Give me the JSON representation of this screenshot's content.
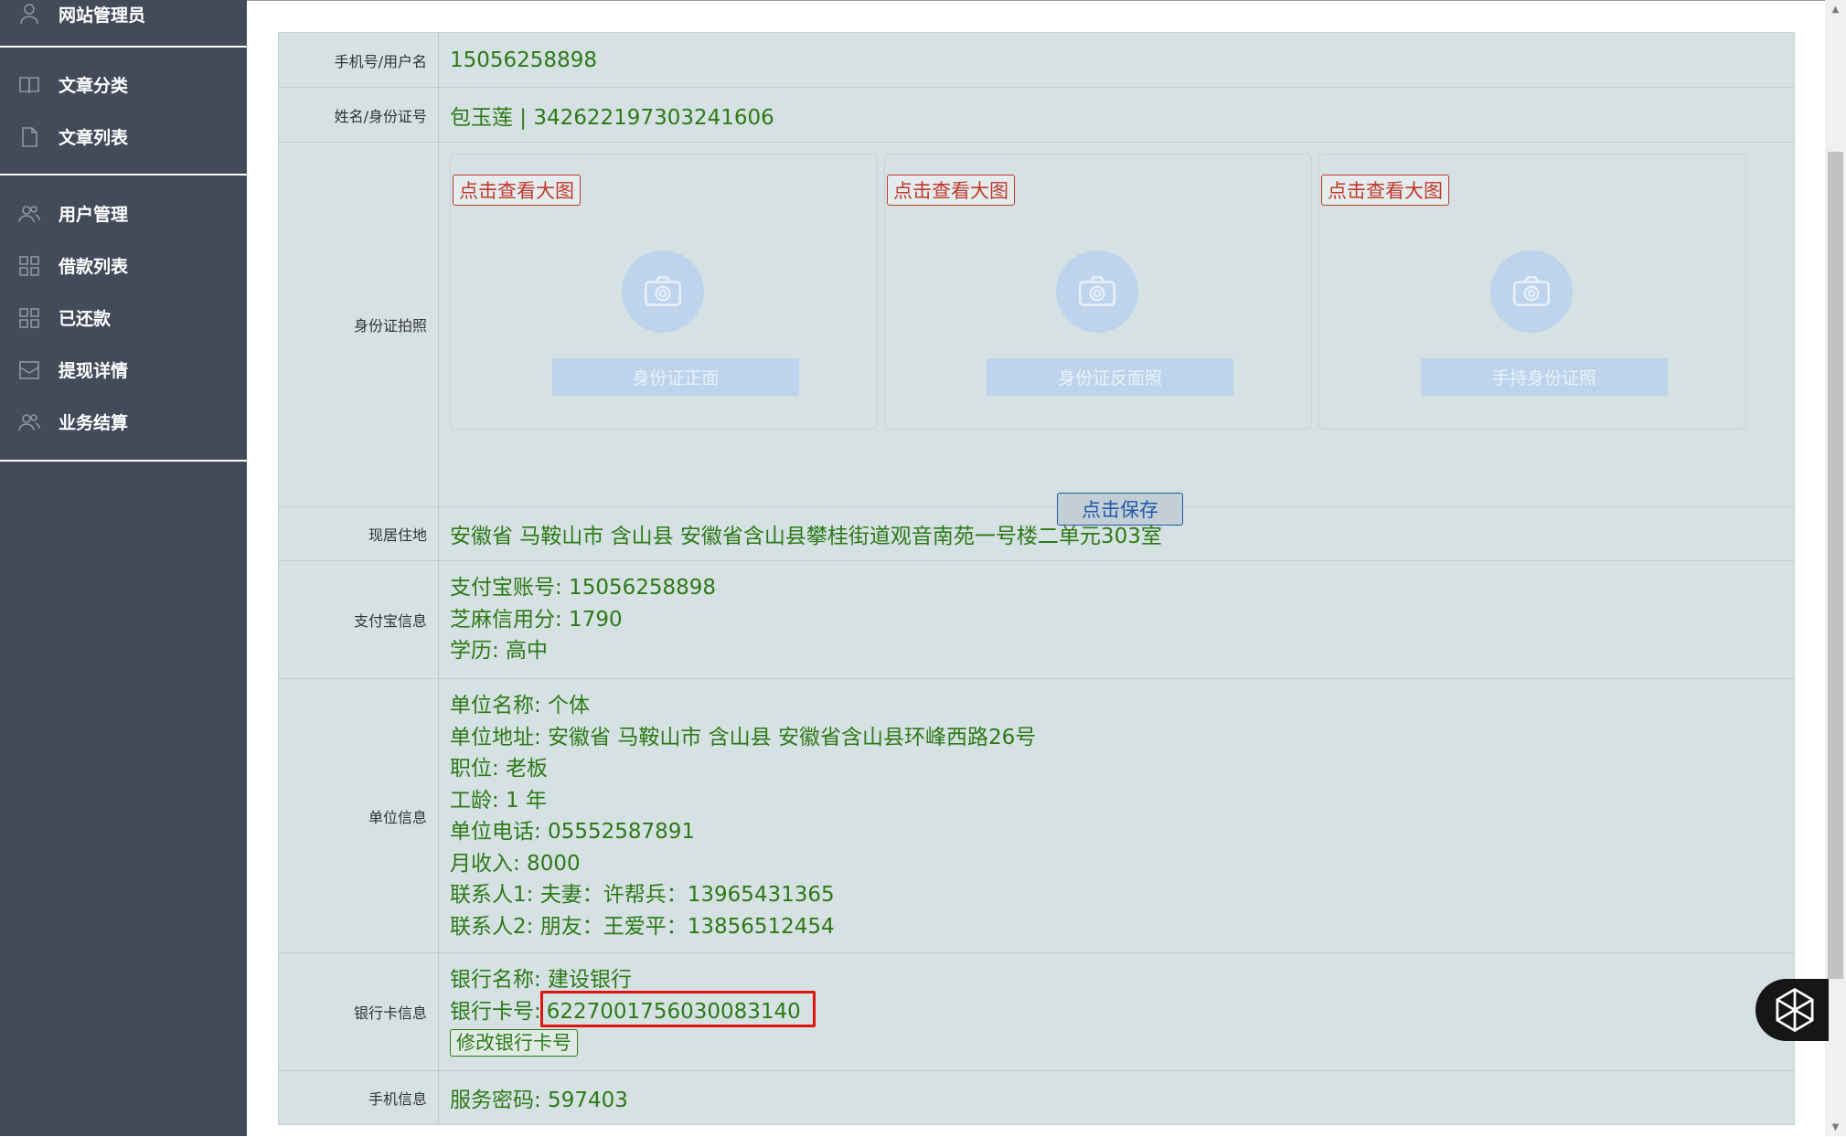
{
  "sidebar": {
    "items": [
      {
        "label": "网站管理员",
        "icon": "user-icon"
      },
      {
        "label": "文章分类",
        "icon": "book-icon"
      },
      {
        "label": "文章列表",
        "icon": "document-icon"
      },
      {
        "label": "用户管理",
        "icon": "users-icon"
      },
      {
        "label": "借款列表",
        "icon": "grid-icon"
      },
      {
        "label": "已还款",
        "icon": "grid-icon"
      },
      {
        "label": "提现详情",
        "icon": "inbox-icon"
      },
      {
        "label": "业务结算",
        "icon": "users-icon"
      }
    ]
  },
  "detail": {
    "phone": {
      "label": "手机号/用户名",
      "value": "15056258898"
    },
    "name": {
      "label": "姓名/身份证号",
      "value": "包玉莲 | 342622197303241606"
    },
    "photos": {
      "label": "身份证拍照",
      "view_label": "点击查看大图",
      "cards": [
        {
          "upload_label": "身份证正面"
        },
        {
          "upload_label": "身份证反面照"
        },
        {
          "upload_label": "手持身份证照"
        }
      ],
      "save_label": "点击保存"
    },
    "address": {
      "label": "现居住地",
      "value": "安徽省 马鞍山市 含山县 安徽省含山县攀桂街道观音南苑一号楼二单元303室"
    },
    "alipay": {
      "label": "支付宝信息",
      "lines": [
        "支付宝账号: 15056258898",
        "芝麻信用分: 1790",
        "学历: 高中"
      ]
    },
    "work": {
      "label": "单位信息",
      "lines": [
        "单位名称: 个体",
        "单位地址: 安徽省 马鞍山市 含山县 安徽省含山县环峰西路26号",
        "职位: 老板",
        "工龄: 1 年",
        "单位电话: 05552587891",
        "月收入: 8000",
        "联系人1: 夫妻：许帮兵：13965431365",
        "联系人2: 朋友：王爱平：13856512454"
      ]
    },
    "bank": {
      "label": "银行卡信息",
      "bank_name": "银行名称: 建设银行",
      "card_prefix": "银行卡号:",
      "card_number": "6227001756030083140",
      "edit_label": "修改银行卡号"
    },
    "mobile": {
      "label": "手机信息",
      "value": "服务密码: 597403"
    }
  },
  "colors": {
    "sidebar_bg": "#434b5b",
    "panel_bg": "#d6e1e3",
    "value_text": "#2c7a17",
    "highlight": "#e0140f"
  }
}
